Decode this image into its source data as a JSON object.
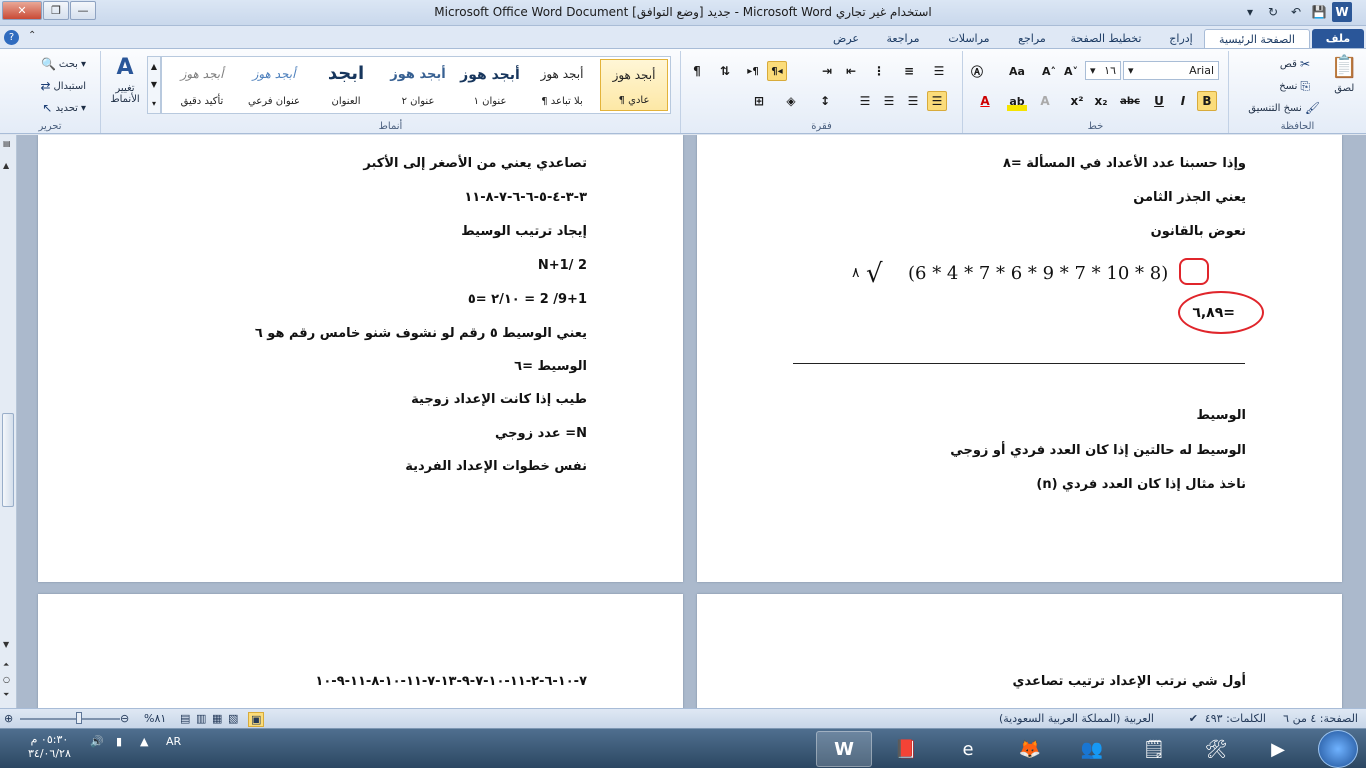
{
  "window": {
    "title": "Microsoft Office Word Document جديد [وضع التوافق] - Microsoft Word استخدام غير تجاري"
  },
  "ribbon_tabs": {
    "file": "ملف",
    "home": "الصفحة الرئيسية",
    "insert": "إدراج",
    "page_layout": "تخطيط الصفحة",
    "references": "مراجع",
    "mailings": "مراسلات",
    "review": "مراجعة",
    "view": "عرض"
  },
  "clipboard": {
    "paste": "لصق",
    "cut": "قص",
    "copy": "نسخ",
    "format_painter": "نسخ التنسيق",
    "label": "الحافظة"
  },
  "font": {
    "name": "Arial",
    "size": "١٦",
    "label": "خط"
  },
  "paragraph": {
    "label": "فقرة"
  },
  "styles": {
    "label": "أنماط",
    "change_styles": "تغيير الأنماط",
    "items": [
      {
        "preview": "أبجد هوز",
        "name": "¶ عادي"
      },
      {
        "preview": "أبجد هوز",
        "name": "¶ بلا تباعد"
      },
      {
        "preview": "أبجد هوز",
        "name": "عنوان ١"
      },
      {
        "preview": "أبجد هوز",
        "name": "عنوان ٢"
      },
      {
        "preview": "ابجد",
        "name": "العنوان"
      },
      {
        "preview": "أبجد هوز",
        "name": "عنوان فرعي"
      },
      {
        "preview": "أبجد هوز",
        "name": "تأكيد دقيق"
      }
    ]
  },
  "editing": {
    "find": "بحث",
    "replace": "استبدال",
    "select": "تحديد",
    "label": "تحرير"
  },
  "page_right": {
    "lines": [
      "وإذا حسبنا عدد الأعداد في المسألة  =٨",
      "يعني الجذر الثامن",
      "نعوض بالقانون",
      "الوسيط",
      "الوسيط له حالتين إذا كان العدد فردي  أو زوجي",
      "ناخذ مثال إذا كان العدد فردي  (n)"
    ],
    "equation": "(6  *  4  *  7  *  6  *  9  *  7  *  10  *  8)",
    "root_index": "٨",
    "result": "=٦,٨٩"
  },
  "page_left": {
    "lines": [
      "تصاعدي يعني من الأصغر  إلى الأكبر",
      "٣-٣-٤-٥-٦-٦-٧-٨-١١",
      "إيجاد ترتيب الوسيط",
      "N+1/  2",
      "9+1/  2  = ٢/١٠ =٥",
      "يعني الوسيط ٥ رقم لو نشوف شنو خامس رقم  هو  ٦",
      "الوسيط =٦",
      "طيب إذا كانت الإعداد زوجية",
      "N= عدد زوجي",
      "نفس خطوات الإعداد الفردية"
    ]
  },
  "page_right_bottom": {
    "line": "أول شي نرتب  الإعداد ترتيب تصاعدي"
  },
  "page_left_bottom": {
    "line": "٧-١٠-٦-٢-١١-١٠-٧-٩-١٣-٧-١١-١٠-٨-١١-٩-١٠"
  },
  "statusbar": {
    "page": "الصفحة: ٤ من ٦",
    "words": "الكلمات: ٤٩٣",
    "language": "العربية (المملكة العربية السعودية)",
    "zoom": "%٨١"
  },
  "tray": {
    "lang": "AR",
    "time": "٠٥:٣٠ م",
    "date": "٣٤/٠٦/٢٨"
  }
}
